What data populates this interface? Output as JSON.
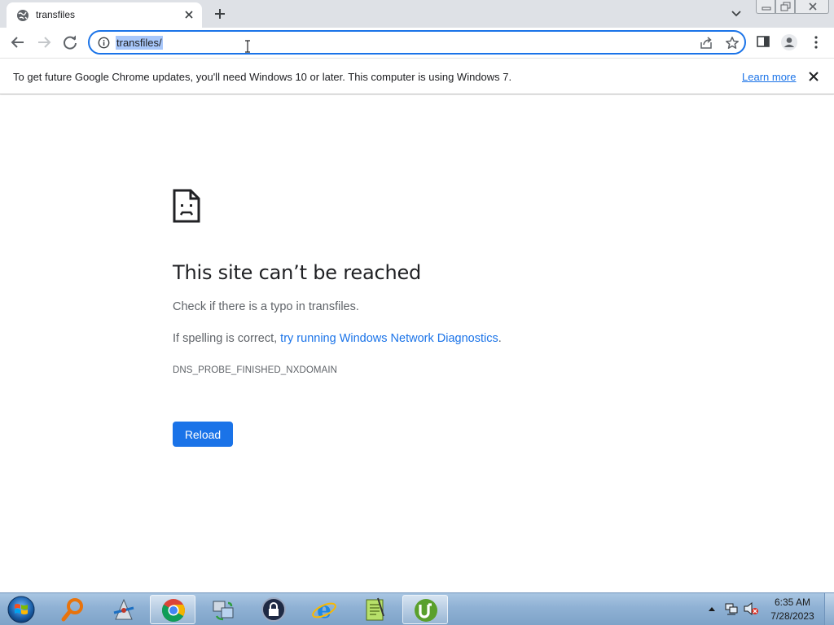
{
  "tab": {
    "title": "transfiles",
    "favicon": "globe-icon"
  },
  "omnibox": {
    "url": "transfiles/"
  },
  "infobar": {
    "message": "To get future Google Chrome updates, you'll need Windows 10 or later. This computer is using Windows 7.",
    "link_label": "Learn more"
  },
  "error_page": {
    "title": "This site can’t be reached",
    "line1": "Check if there is a typo in transfiles.",
    "line2_prefix": "If spelling is correct, ",
    "line2_link": "try running Windows Network Diagnostics",
    "line2_suffix": ".",
    "error_code": "DNS_PROBE_FINISHED_NXDOMAIN",
    "reload_label": "Reload"
  },
  "taskbar": {
    "pinned_icons": [
      "search-app-icon",
      "network-tool-icon",
      "chrome-icon",
      "file-transfer-icon",
      "lock-app-icon",
      "internet-explorer-icon",
      "notepad-icon",
      "utorrent-icon"
    ],
    "active_app": "chrome-icon",
    "clock_time": "6:35 AM",
    "clock_date": "7/28/2023"
  },
  "colors": {
    "accent": "#1a73e8",
    "tabstrip": "#dee1e6",
    "url_selection": "#a8c7fa"
  }
}
